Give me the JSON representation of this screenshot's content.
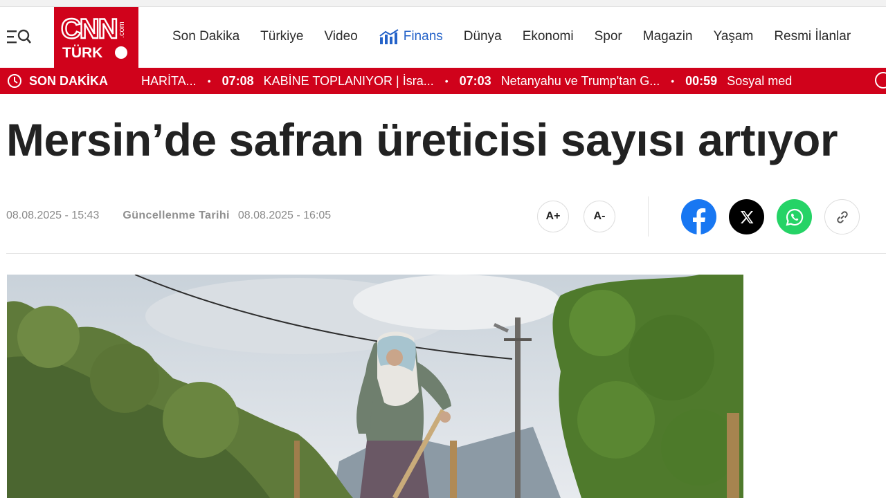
{
  "brand": {
    "logo_primary": "CNN",
    "logo_secondary": "TÜRK",
    "logo_com": ".com",
    "color": "#d0021b"
  },
  "nav": {
    "items": [
      "Son Dakika",
      "Türkiye",
      "Video",
      "Finans",
      "Dünya",
      "Ekonomi",
      "Spor",
      "Magazin",
      "Yaşam",
      "Resmi İlanlar"
    ],
    "highlight_color": "#2563c9",
    "menu_icon": "menu-search-icon"
  },
  "ticker": {
    "label": "SON DAKİKA",
    "items": [
      {
        "time": "",
        "text": "HARİTA..."
      },
      {
        "time": "07:08",
        "text": "KABİNE TOPLANIYOR | İsra..."
      },
      {
        "time": "07:03",
        "text": "Netanyahu ve Trump'tan G..."
      },
      {
        "time": "00:59",
        "text": "Sosyal med"
      }
    ]
  },
  "article": {
    "title": "Mersin’de safran üreticisi sayısı artıyor",
    "published": "08.08.2025 - 15:43",
    "updated_label": "Güncellenme Tarihi",
    "updated": "08.08.2025 - 16:05"
  },
  "font_controls": {
    "increase": "A+",
    "decrease": "A-"
  },
  "share": {
    "facebook_color": "#1877f2",
    "x_color": "#000000",
    "whatsapp_color": "#25d366"
  }
}
